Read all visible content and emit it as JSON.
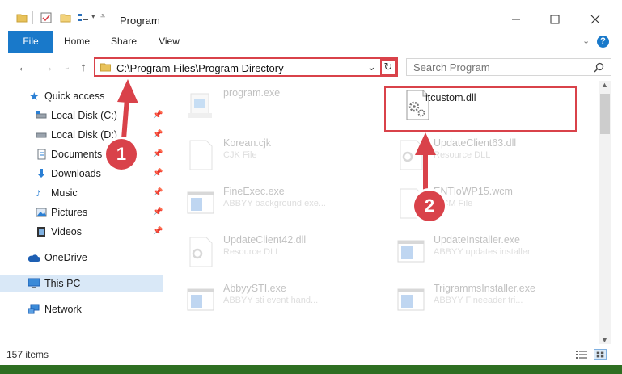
{
  "window": {
    "title": "Program"
  },
  "ribbon": {
    "tabs": [
      "File",
      "Home",
      "Share",
      "View"
    ]
  },
  "address": {
    "path": "C:\\Program Files\\Program Directory",
    "search_placeholder": "Search Program"
  },
  "nav": {
    "items": [
      {
        "label": "Quick access",
        "icon": "star-icon",
        "pinned": false
      },
      {
        "label": "Local Disk (C:)",
        "icon": "drive-icon",
        "pinned": true
      },
      {
        "label": "Local Disk (D:)",
        "icon": "drive-icon",
        "pinned": true
      },
      {
        "label": "Documents",
        "icon": "documents-icon",
        "pinned": true
      },
      {
        "label": "Downloads",
        "icon": "download-icon",
        "pinned": true
      },
      {
        "label": "Music",
        "icon": "music-icon",
        "pinned": true
      },
      {
        "label": "Pictures",
        "icon": "pictures-icon",
        "pinned": true
      },
      {
        "label": "Videos",
        "icon": "videos-icon",
        "pinned": true
      },
      {
        "label": "OneDrive",
        "icon": "cloud-icon",
        "pinned": false
      },
      {
        "label": "This PC",
        "icon": "computer-icon",
        "pinned": false
      },
      {
        "label": "Network",
        "icon": "network-icon",
        "pinned": false
      }
    ]
  },
  "files": [
    {
      "name": "program.exe",
      "type": "",
      "icon": "exe-icon"
    },
    {
      "name": "itcustom.dll",
      "type": "",
      "icon": "gear-file-icon"
    },
    {
      "name": "Korean.cjk",
      "type": "CJK File",
      "icon": "blank-file-icon"
    },
    {
      "name": "UpdateClient63.dll",
      "type": "Resource DLL",
      "icon": "gear-file-icon"
    },
    {
      "name": "FineExec.exe",
      "type": "ABBYY background exe...",
      "icon": "app-window-icon"
    },
    {
      "name": "ENTloWP15.wcm",
      "type": "WCM File",
      "icon": "blank-file-icon"
    },
    {
      "name": "UpdateClient42.dll",
      "type": "Resource DLL",
      "icon": "gear-file-icon"
    },
    {
      "name": "UpdateInstaller.exe",
      "type": "ABBYY updates installer",
      "icon": "app-window-icon"
    },
    {
      "name": "AbbyySTI.exe",
      "type": "ABBYY sti event hand...",
      "icon": "app-window-icon"
    },
    {
      "name": "TrigrammsInstaller.exe",
      "type": "ABBYY Fineeader tri...",
      "icon": "app-window-icon"
    }
  ],
  "status": {
    "count": "157 items"
  },
  "callouts": [
    "1",
    "2"
  ],
  "colors": {
    "accent": "#1979ca",
    "highlight": "#d9424a"
  }
}
